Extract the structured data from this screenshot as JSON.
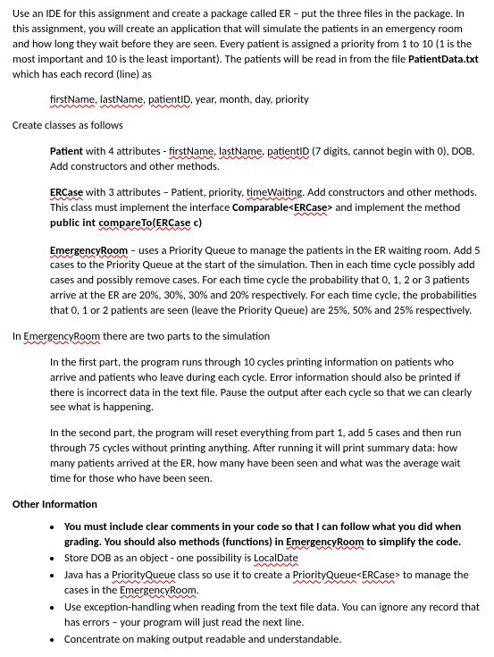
{
  "intro": {
    "p1a": "Use an IDE for this assignment and create a package called ER – put the three files in the package. In this assignment, you will create an application that will simulate the patients in an emergency room and how long they wait before they are seen. Every patient is assigned a priority from 1 to 10 (1 is the most important and 10 is the least important). The patients will be read in from the file ",
    "p1b": "PatientData.txt",
    "p1c": " which has each record (line) as"
  },
  "recordLine": {
    "firstName": "firstName",
    "sep1": ", ",
    "lastName": "lastName",
    "sep2": ", ",
    "patientID": "patientID",
    "sep3": ", year, month, day, priority"
  },
  "createClasses": "Create classes as follows",
  "patient": {
    "pre": "Patient",
    "mid1": " with 4 attributes - ",
    "fn": "firstName",
    "c1": ", ",
    "ln": "lastName",
    "c2": ", ",
    "pid": "patientID",
    "post": " (7 digits, cannot begin with 0), DOB. Add constructors and other methods."
  },
  "ercase": {
    "name": "ERCase",
    "mid1": " with 3 attributes – Patient, priority, ",
    "tw": "timeWaiting",
    "post": ". Add constructors and other methods. This class must implement the interface ",
    "iface1": "Comparable<",
    "iface2": "ERCase",
    "iface3": ">",
    "post2": " and implement the method",
    "code1": "public int ",
    "code2": "compareTo(ERCase",
    "code3": " c)"
  },
  "emergencyRoom": {
    "name": "EmergencyRoom",
    "text": " – uses a Priority Queue to manage the patients in the ER waiting room. Add 5 cases to the Priority Queue at the start of the simulation. Then in each time cycle possibly add cases and possibly remove cases. For each time cycle the probability that 0, 1, 2 or 3 patients arrive at the ER are 20%, 30%, 30% and 20% respectively. For each time cycle, the probabilities that 0, 1 or 2 patients are seen (leave the Priority Queue) are 25%, 50% and 25% respectively."
  },
  "inER": {
    "pre": "In ",
    "name": "EmergencyRoom",
    "post": " there are two parts to the simulation"
  },
  "part1": "In the first part, the program runs through 10 cycles printing information on patients who arrive and patients who leave during each cycle. Error information should also be printed if there is incorrect data in the text file. Pause the output after each cycle so that we can clearly see what is happening.",
  "part2": "In the second part, the program will reset everything from part 1, add 5 cases and then run through 75 cycles without printing anything. After running it will print summary data: how many patients arrived at the ER, how many have been seen and what was the average wait time for those who have been seen.",
  "otherInfoHeading": "Other Information",
  "bullets": {
    "b1a": "You must include clear comments in your code so that I can follow what you did when grading. You should also methods (functions) in ",
    "b1b": "EmergencyRoom",
    "b1c": " to simplify the code.",
    "b2a": "Store DOB as an object - one possibility is ",
    "b2b": "LocalDate",
    "b3a": "Java has a ",
    "b3b": "PriorityQueue",
    "b3c": " class so use it to create a ",
    "b3d": "PriorityQueue",
    "b3e": "<",
    "b3f": "ERCase",
    "b3g": "> to manage the cases in the ",
    "b3h": "EmergencyRoom",
    "b3i": ".",
    "b4": "Use exception-handling when reading from the text file data. You can ignore any record that has errors – your program will just read the next line.",
    "b5": "Concentrate on making output readable and understandable."
  }
}
